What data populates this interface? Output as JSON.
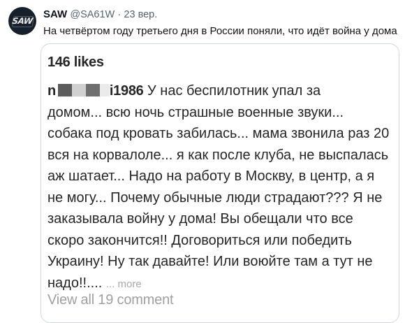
{
  "tweet": {
    "avatar_text": "SAW",
    "avatar_icon": "saw-logo-icon",
    "display_name": "SAW",
    "handle": "@SA61W",
    "separator": "·",
    "date": "23 вер.",
    "text": "На четвёртом году третьего дня в России поняли, что идёт война у дома"
  },
  "card": {
    "likes": "146 likes",
    "username_visible": "i1986",
    "comment_first": "У нас беспилотник упал за",
    "comment_lines": [
      "домом... всю ночь страшные военные звуки...",
      "собака под кровать забилась... мама звонила раз 20",
      "вся на корвалоле... я как после клуба, не выспалась",
      "аж шатает... Надо на работу в Москву, в центр, а я",
      "не могу... Почему обычные люди страдают??? Я не",
      "заказывала войну у дома! Вы обещали что все",
      "скоро закончится!! Договориться или победить",
      "Украину! Ну так давайте! Или воюйте там а тут не"
    ],
    "comment_last": "надо!!....",
    "more": "... more",
    "view_all": "View all 19 comment"
  }
}
